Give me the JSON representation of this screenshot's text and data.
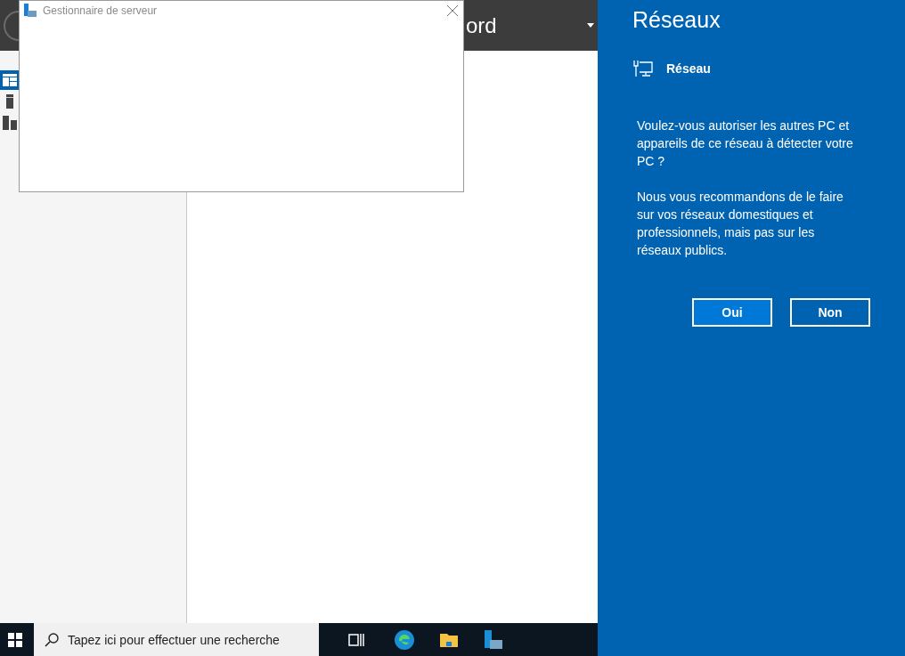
{
  "background_window": {
    "header_title": "ord",
    "nav_items": [
      {
        "kind": "dashboard",
        "selected": true
      },
      {
        "kind": "server",
        "selected": false
      },
      {
        "kind": "servers",
        "selected": false
      }
    ]
  },
  "dialog": {
    "title": "Gestionnaire de serveur"
  },
  "taskbar": {
    "search": {
      "placeholder": "Tapez ici pour effectuer une recherche"
    }
  },
  "flyout": {
    "title": "Réseaux",
    "network": "Réseau",
    "paragraphs": [
      "Voulez-vous autoriser les autres PC et appareils de ce réseau à détecter votre PC ?",
      "Nous vous recommandons de le faire sur vos réseaux domestiques et professionnels, mais pas sur les réseaux publics."
    ],
    "buttons": [
      {
        "label": "Oui",
        "selected": true
      },
      {
        "label": "Non",
        "selected": false
      }
    ]
  }
}
